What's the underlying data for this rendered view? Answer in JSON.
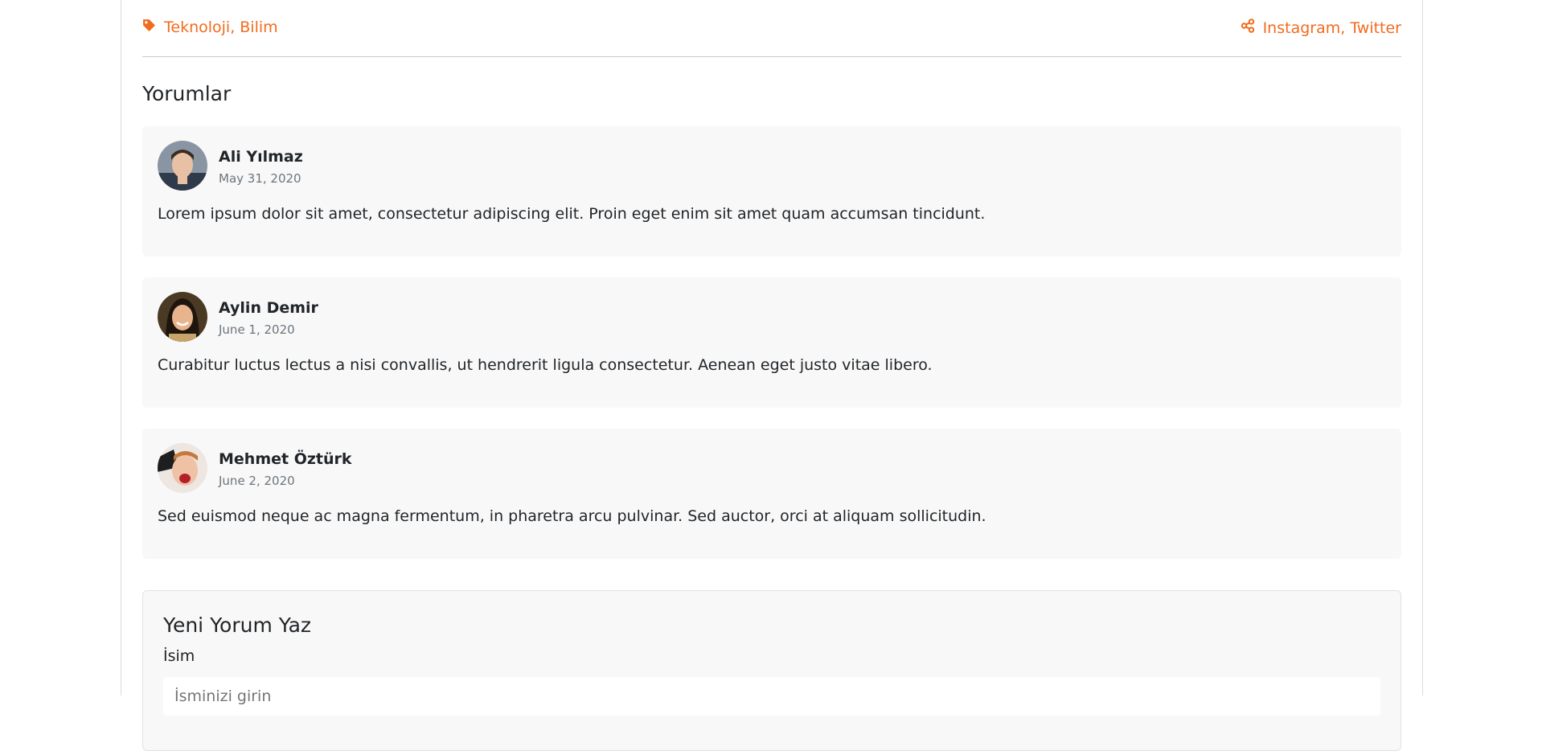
{
  "post_meta": {
    "tags": "Teknoloji, Bilim",
    "shares": "Instagram, Twitter",
    "tag_icon": "tag-icon",
    "share_icon": "share-icon",
    "accent_color": "#f26b1d"
  },
  "comments_section": {
    "title": "Yorumlar",
    "comments": [
      {
        "author": "Ali Yılmaz",
        "date": "May 31, 2020",
        "text": "Lorem ipsum dolor sit amet, consectetur adipiscing elit. Proin eget enim sit amet quam accumsan tincidunt."
      },
      {
        "author": "Aylin Demir",
        "date": "June 1, 2020",
        "text": "Curabitur luctus lectus a nisi convallis, ut hendrerit ligula consectetur. Aenean eget justo vitae libero."
      },
      {
        "author": "Mehmet Öztürk",
        "date": "June 2, 2020",
        "text": "Sed euismod neque ac magna fermentum, in pharetra arcu pulvinar. Sed auctor, orci at aliquam sollicitudin."
      }
    ]
  },
  "new_comment": {
    "title": "Yeni Yorum Yaz",
    "name_label": "İsim",
    "name_placeholder": "İsminizi girin"
  }
}
